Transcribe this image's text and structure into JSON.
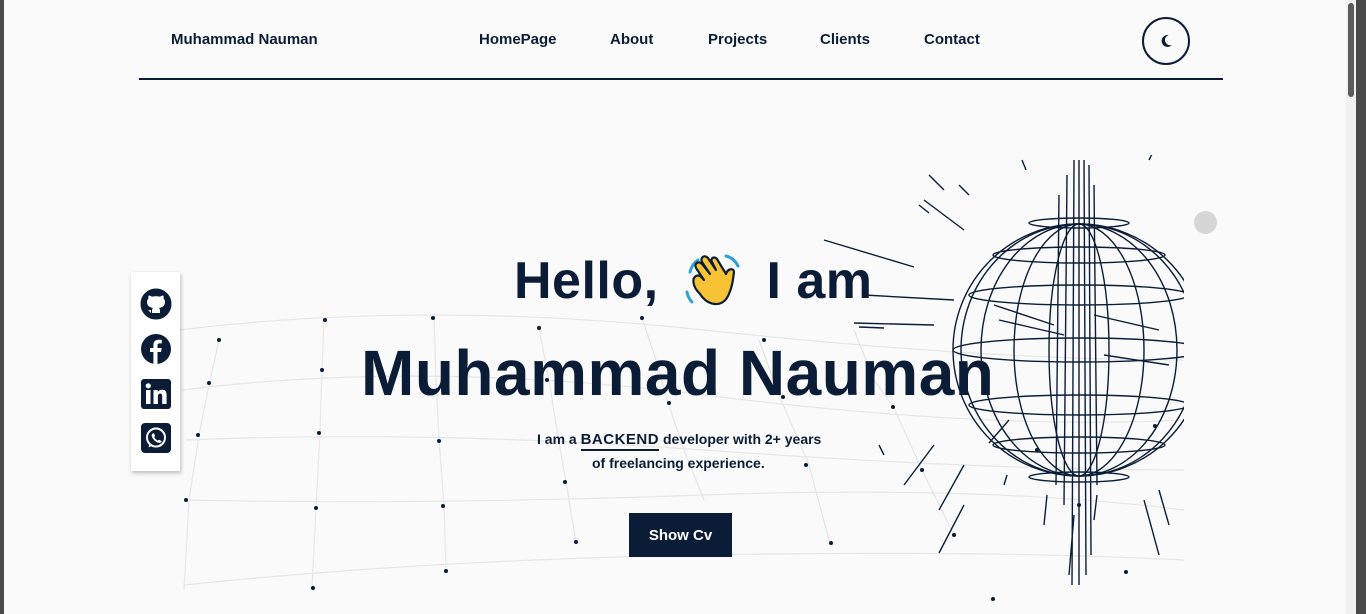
{
  "header": {
    "brand": "Muhammad Nauman",
    "nav": [
      {
        "label": "HomePage"
      },
      {
        "label": "About"
      },
      {
        "label": "Projects"
      },
      {
        "label": "Clients"
      },
      {
        "label": "Contact"
      }
    ],
    "theme_icon": "moon-icon"
  },
  "social": [
    {
      "icon": "github-icon"
    },
    {
      "icon": "facebook-icon"
    },
    {
      "icon": "linkedin-icon"
    },
    {
      "icon": "whatsapp-icon"
    }
  ],
  "hero": {
    "greeting": "Hello,",
    "greeting_suffix": "I am",
    "wave_icon": "waving-hand-icon",
    "name": "Muhammad Nauman",
    "intro_prefix": "I am a",
    "role": "BACKEND",
    "intro_suffix": "developer with 2+ years",
    "intro_line2": "of freelancing experience.",
    "cv_button": "Show Cv"
  },
  "colors": {
    "primary": "#0b1d36",
    "background": "#fafafa",
    "wave_yellow": "#f7c234"
  }
}
